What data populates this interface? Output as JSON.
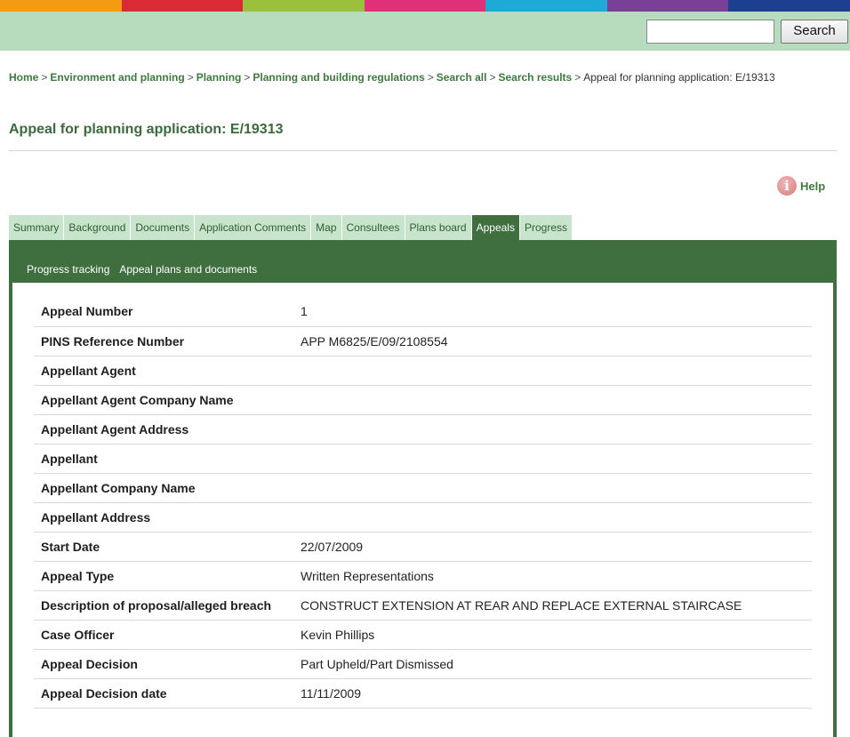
{
  "stripe_colors": [
    "#f39c12",
    "#d92b36",
    "#9bc13c",
    "#e1307a",
    "#1eaad6",
    "#7a3f96",
    "#1d3f8f"
  ],
  "search": {
    "value": "",
    "button_label": "Search"
  },
  "breadcrumb": {
    "items": [
      "Home",
      "Environment and planning",
      "Planning",
      "Planning and building regulations",
      "Search all",
      "Search results"
    ],
    "current": "Appeal for planning application: E/19313",
    "separator": ">"
  },
  "page_title": "Appeal for planning application: E/19313",
  "help_label": "Help",
  "tabs": [
    {
      "label": "Summary",
      "active": false
    },
    {
      "label": "Background",
      "active": false
    },
    {
      "label": "Documents",
      "active": false
    },
    {
      "label": "Application Comments",
      "active": false
    },
    {
      "label": "Map",
      "active": false
    },
    {
      "label": "Consultees",
      "active": false
    },
    {
      "label": "Plans board",
      "active": false
    },
    {
      "label": "Appeals",
      "active": true
    },
    {
      "label": "Progress",
      "active": false
    }
  ],
  "subnav": [
    "Progress tracking",
    "Appeal plans and documents"
  ],
  "details": [
    {
      "label": "Appeal Number",
      "value": "1"
    },
    {
      "label": "PINS Reference Number",
      "value": "APP M6825/E/09/2108554"
    },
    {
      "label": "Appellant Agent",
      "value": ""
    },
    {
      "label": "Appellant Agent Company Name",
      "value": ""
    },
    {
      "label": "Appellant Agent Address",
      "value": ""
    },
    {
      "label": "Appellant",
      "value": ""
    },
    {
      "label": "Appellant Company Name",
      "value": ""
    },
    {
      "label": "Appellant Address",
      "value": ""
    },
    {
      "label": "Start Date",
      "value": "22/07/2009"
    },
    {
      "label": "Appeal Type",
      "value": "Written Representations"
    },
    {
      "label": "Description of proposal/alleged breach",
      "value": "CONSTRUCT EXTENSION AT REAR AND REPLACE EXTERNAL STAIRCASE"
    },
    {
      "label": "Case Officer",
      "value": "Kevin Phillips"
    },
    {
      "label": "Appeal Decision",
      "value": "Part Upheld/Part Dismissed"
    },
    {
      "label": "Appeal Decision date",
      "value": "11/11/2009"
    }
  ]
}
